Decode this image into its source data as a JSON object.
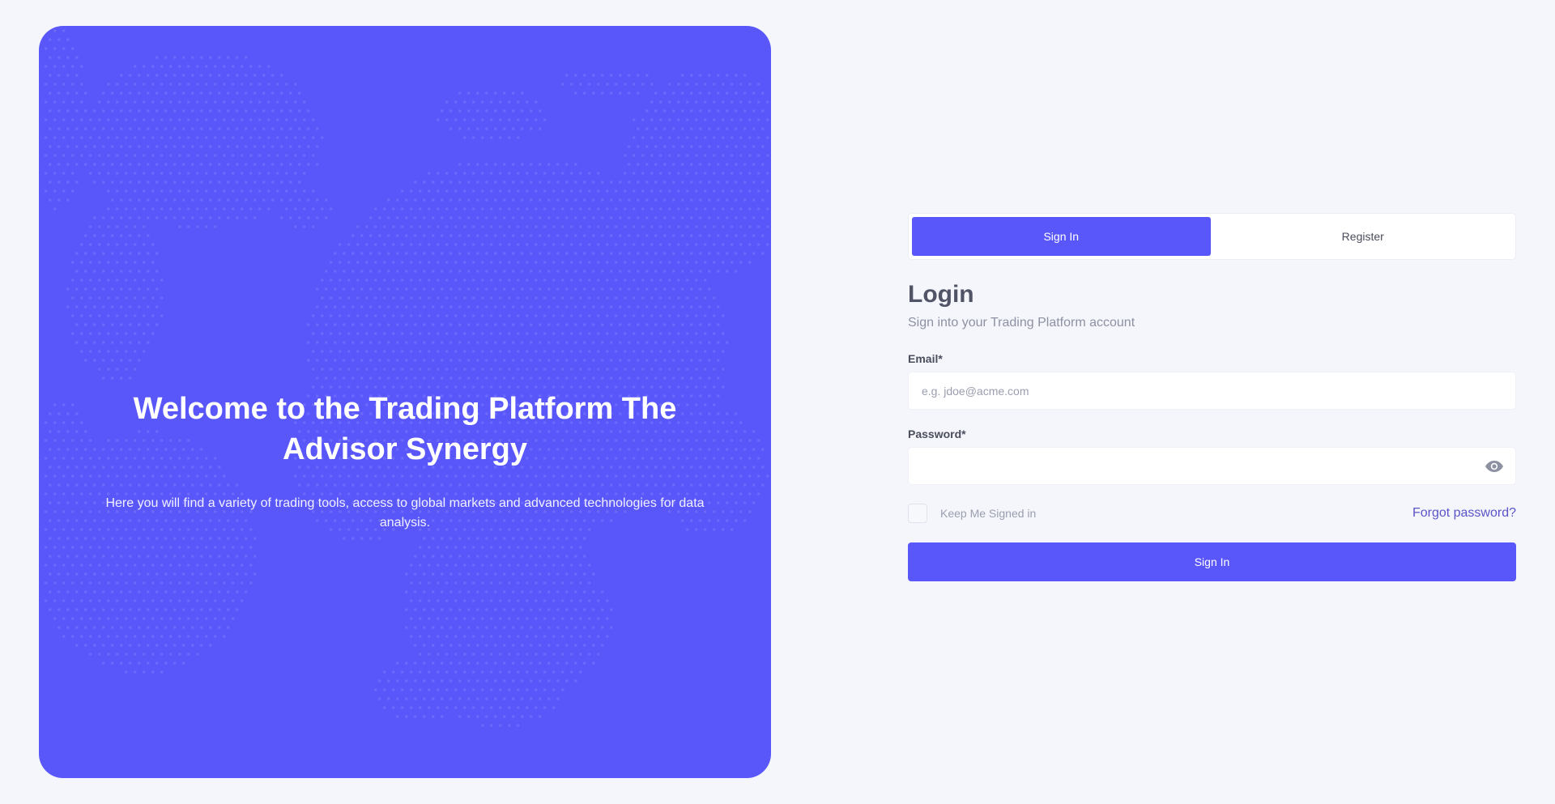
{
  "hero": {
    "title": "Welcome to the Trading Platform The Advisor Synergy",
    "subtitle": "Here you will find a variety of trading tools, access to global markets and advanced technologies for data analysis.",
    "background_color": "#5a57fa",
    "decoration": "dotted-world-map"
  },
  "tabs": [
    {
      "label": "Sign In",
      "active": true
    },
    {
      "label": "Register",
      "active": false
    }
  ],
  "login": {
    "title": "Login",
    "subtitle": "Sign into your Trading Platform account"
  },
  "form": {
    "email_label": "Email*",
    "email_placeholder": "e.g. jdoe@acme.com",
    "email_value": "",
    "password_label": "Password*",
    "password_value": "",
    "password_toggle_icon": "eye-icon",
    "keep_signed_in_label": "Keep Me Signed in",
    "keep_signed_in_checked": false,
    "forgot_password": "Forgot password?",
    "submit_label": "Sign In"
  },
  "colors": {
    "accent": "#5a57fa",
    "page_background": "#f5f6fc",
    "link": "#5a54c8"
  }
}
